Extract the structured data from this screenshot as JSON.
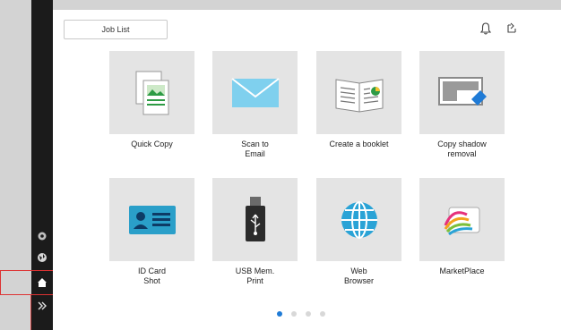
{
  "header": {
    "job_list_label": "Job List",
    "icons": [
      "bell-icon",
      "refresh-icon"
    ]
  },
  "sidebar": {
    "icons": [
      "settings-icon",
      "globe-icon",
      "home-icon",
      "expand-icon"
    ],
    "highlighted": "home-icon"
  },
  "tiles": [
    {
      "label": "Quick Copy",
      "icon": "copy-document-icon"
    },
    {
      "label": "Scan to\nEmail",
      "icon": "envelope-icon"
    },
    {
      "label": "Create a booklet",
      "icon": "booklet-icon"
    },
    {
      "label": "Copy shadow\nremoval",
      "icon": "eraser-screen-icon"
    },
    {
      "label": "ID Card\nShot",
      "icon": "id-card-icon"
    },
    {
      "label": "USB Mem.\nPrint",
      "icon": "usb-drive-icon"
    },
    {
      "label": "Web\nBrowser",
      "icon": "globe-icon"
    },
    {
      "label": "MarketPlace",
      "icon": "marketplace-icon"
    }
  ],
  "pagination": {
    "current_page": 1,
    "total_pages": 4
  },
  "colors": {
    "accent": "#1f7bd6",
    "tile_bg": "#e4e4e4",
    "rail_bg": "#1b1b1b",
    "highlight": "#dd3333"
  }
}
